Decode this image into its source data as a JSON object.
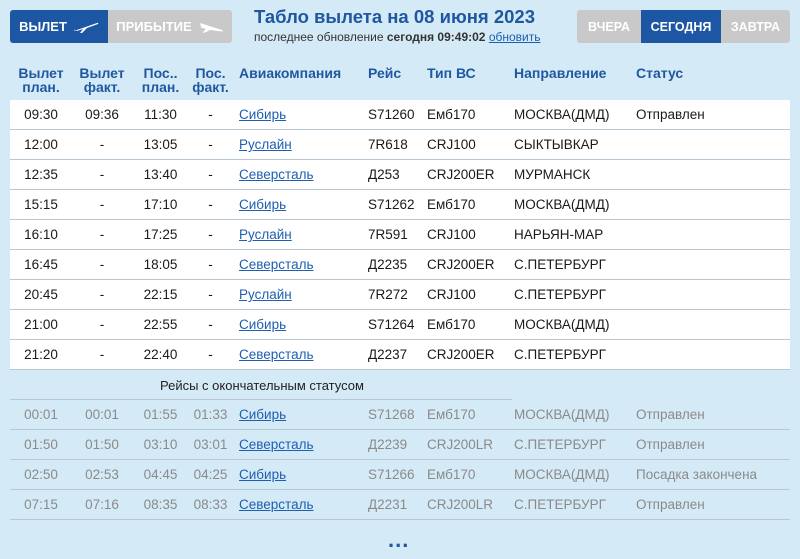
{
  "header": {
    "departure_label": "ВЫЛЕТ",
    "arrival_label": "ПРИБЫТИЕ",
    "title": "Табло вылета на 08 июня 2023",
    "update_prefix": "последнее обновление",
    "update_time": "сегодня 09:49:02",
    "refresh_link": "обновить",
    "days": [
      "ВЧЕРА",
      "СЕГОДНЯ",
      "ЗАВТРА"
    ],
    "active_day": "СЕГОДНЯ"
  },
  "columns": [
    [
      "Вылет",
      "план."
    ],
    [
      "Вылет",
      "факт."
    ],
    [
      "Пос..",
      "план."
    ],
    [
      "Пос.",
      "факт."
    ],
    [
      "Авиакомпания",
      ""
    ],
    [
      "Рейс",
      ""
    ],
    [
      "Тип ВС",
      ""
    ],
    [
      "Направление",
      ""
    ],
    [
      "Статус",
      ""
    ]
  ],
  "current_flights": [
    {
      "dep_plan": "09:30",
      "dep_fact": "09:36",
      "arr_plan": "11:30",
      "arr_fact": "-",
      "airline": "Сибирь",
      "flight": "S71260",
      "aircraft": "Емб170",
      "destination": "МОСКВА(ДМД)",
      "status": "Отправлен"
    },
    {
      "dep_plan": "12:00",
      "dep_fact": "-",
      "arr_plan": "13:05",
      "arr_fact": "-",
      "airline": "Руслайн",
      "flight": "7R618",
      "aircraft": "CRJ100",
      "destination": "СЫКТЫВКАР",
      "status": ""
    },
    {
      "dep_plan": "12:35",
      "dep_fact": "-",
      "arr_plan": "13:40",
      "arr_fact": "-",
      "airline": "Северсталь",
      "flight": "Д253",
      "aircraft": "CRJ200ER",
      "destination": "МУРМАНСК",
      "status": ""
    },
    {
      "dep_plan": "15:15",
      "dep_fact": "-",
      "arr_plan": "17:10",
      "arr_fact": "-",
      "airline": "Сибирь",
      "flight": "S71262",
      "aircraft": "Емб170",
      "destination": "МОСКВА(ДМД)",
      "status": ""
    },
    {
      "dep_plan": "16:10",
      "dep_fact": "-",
      "arr_plan": "17:25",
      "arr_fact": "-",
      "airline": "Руслайн",
      "flight": "7R591",
      "aircraft": "CRJ100",
      "destination": "НАРЬЯН-МАР",
      "status": ""
    },
    {
      "dep_plan": "16:45",
      "dep_fact": "-",
      "arr_plan": "18:05",
      "arr_fact": "-",
      "airline": "Северсталь",
      "flight": "Д2235",
      "aircraft": "CRJ200ER",
      "destination": "С.ПЕТЕРБУРГ",
      "status": ""
    },
    {
      "dep_plan": "20:45",
      "dep_fact": "-",
      "arr_plan": "22:15",
      "arr_fact": "-",
      "airline": "Руслайн",
      "flight": "7R272",
      "aircraft": "CRJ100",
      "destination": "С.ПЕТЕРБУРГ",
      "status": ""
    },
    {
      "dep_plan": "21:00",
      "dep_fact": "-",
      "arr_plan": "22:55",
      "arr_fact": "-",
      "airline": "Сибирь",
      "flight": "S71264",
      "aircraft": "Емб170",
      "destination": "МОСКВА(ДМД)",
      "status": ""
    },
    {
      "dep_plan": "21:20",
      "dep_fact": "-",
      "arr_plan": "22:40",
      "arr_fact": "-",
      "airline": "Северсталь",
      "flight": "Д2237",
      "aircraft": "CRJ200ER",
      "destination": "С.ПЕТЕРБУРГ",
      "status": ""
    }
  ],
  "final_section_label": "Рейсы с окончательным статусом",
  "final_flights": [
    {
      "dep_plan": "00:01",
      "dep_fact": "00:01",
      "arr_plan": "01:55",
      "arr_fact": "01:33",
      "airline": "Сибирь",
      "flight": "S71268",
      "aircraft": "Емб170",
      "destination": "МОСКВА(ДМД)",
      "status": "Отправлен"
    },
    {
      "dep_plan": "01:50",
      "dep_fact": "01:50",
      "arr_plan": "03:10",
      "arr_fact": "03:01",
      "airline": "Северсталь",
      "flight": "Д2239",
      "aircraft": "CRJ200LR",
      "destination": "С.ПЕТЕРБУРГ",
      "status": "Отправлен"
    },
    {
      "dep_plan": "02:50",
      "dep_fact": "02:53",
      "arr_plan": "04:45",
      "arr_fact": "04:25",
      "airline": "Сибирь",
      "flight": "S71266",
      "aircraft": "Емб170",
      "destination": "МОСКВА(ДМД)",
      "status": "Посадка закончена"
    },
    {
      "dep_plan": "07:15",
      "dep_fact": "07:16",
      "arr_plan": "08:35",
      "arr_fact": "08:33",
      "airline": "Северсталь",
      "flight": "Д2231",
      "aircraft": "CRJ200LR",
      "destination": "С.ПЕТЕРБУРГ",
      "status": "Отправлен"
    }
  ],
  "more_label": "...",
  "icons": {
    "departure": "plane-takeoff-icon",
    "arrival": "plane-landing-icon"
  },
  "colors": {
    "primary": "#1d57a3",
    "inactive": "#c9c9c9",
    "background": "#d5eaf7",
    "link": "#1f5fb0"
  }
}
